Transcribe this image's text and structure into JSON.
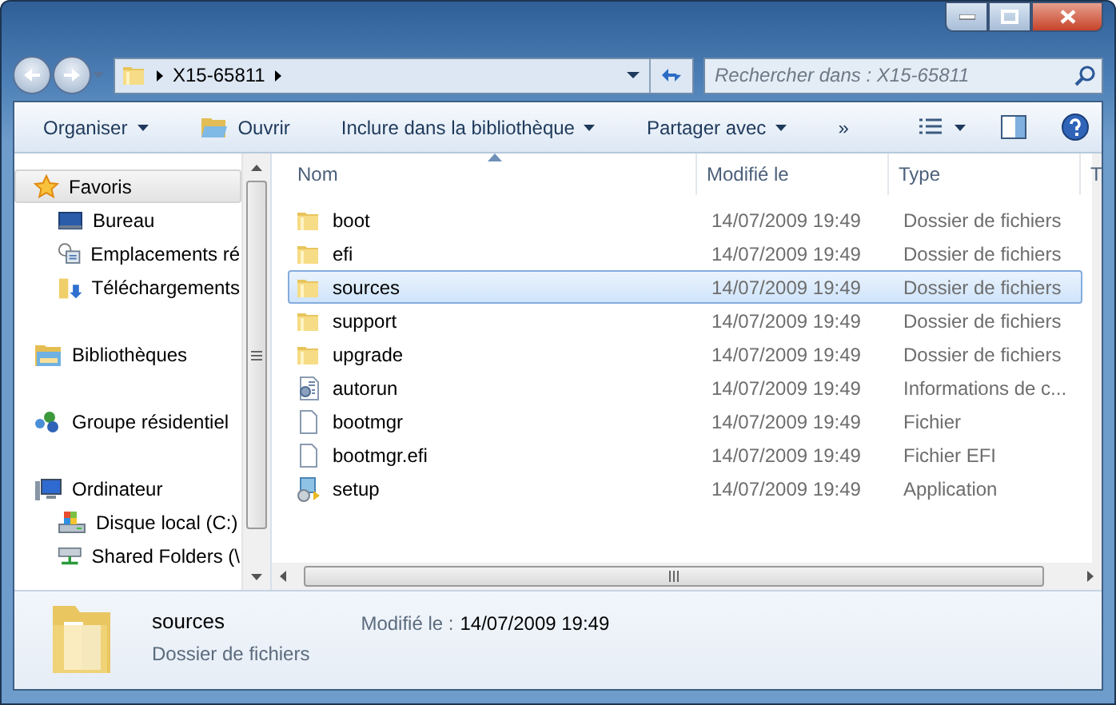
{
  "address_bar": {
    "path": [
      "X15-65811"
    ]
  },
  "search": {
    "placeholder": "Rechercher dans : X15-65811"
  },
  "toolbar": [
    {
      "kind": "menu",
      "label": "Organiser"
    },
    {
      "kind": "open",
      "label": "Ouvrir"
    },
    {
      "kind": "menu",
      "label": "Inclure dans la bibliothèque"
    },
    {
      "kind": "menu",
      "label": "Partager avec"
    },
    {
      "kind": "more",
      "label": "»"
    }
  ],
  "sidebar": {
    "groups": [
      {
        "kind": "star",
        "label": "Favoris",
        "selected": true,
        "children": [
          {
            "kind": "desktop",
            "label": "Bureau",
            "selected": false
          },
          {
            "kind": "places",
            "label": "Emplacements ré",
            "selected": false
          },
          {
            "kind": "downloads",
            "label": "Téléchargements",
            "selected": false
          }
        ]
      },
      {
        "kind": "library",
        "label": "Bibliothèques",
        "selected": false
      },
      {
        "kind": "homegroup",
        "label": "Groupe résidentiel",
        "selected": false
      },
      {
        "kind": "computer",
        "label": "Ordinateur",
        "selected": false,
        "children": [
          {
            "kind": "drive",
            "label": "Disque local (C:)",
            "selected": false
          },
          {
            "kind": "netdrive",
            "label": "Shared Folders (\\",
            "selected": false
          }
        ]
      }
    ]
  },
  "table": {
    "columns": [
      {
        "label": "Nom",
        "sorted": true
      },
      {
        "label": "Modifié le",
        "sorted": false
      },
      {
        "label": "Type",
        "sorted": false
      },
      {
        "label": "T",
        "sorted": false
      }
    ],
    "rows": [
      {
        "kind": "folder",
        "name": "boot",
        "modified": "14/07/2009 19:49",
        "type": "Dossier de fichiers",
        "selected": false
      },
      {
        "kind": "folder",
        "name": "efi",
        "modified": "14/07/2009 19:49",
        "type": "Dossier de fichiers",
        "selected": false
      },
      {
        "kind": "folder",
        "name": "sources",
        "modified": "14/07/2009 19:49",
        "type": "Dossier de fichiers",
        "selected": true
      },
      {
        "kind": "folder",
        "name": "support",
        "modified": "14/07/2009 19:49",
        "type": "Dossier de fichiers",
        "selected": false
      },
      {
        "kind": "folder",
        "name": "upgrade",
        "modified": "14/07/2009 19:49",
        "type": "Dossier de fichiers",
        "selected": false
      },
      {
        "kind": "settings",
        "name": "autorun",
        "modified": "14/07/2009 19:49",
        "type": "Informations de c...",
        "selected": false
      },
      {
        "kind": "file",
        "name": "bootmgr",
        "modified": "14/07/2009 19:49",
        "type": "Fichier",
        "selected": false
      },
      {
        "kind": "file",
        "name": "bootmgr.efi",
        "modified": "14/07/2009 19:49",
        "type": "Fichier EFI",
        "selected": false
      },
      {
        "kind": "setup",
        "name": "setup",
        "modified": "14/07/2009 19:49",
        "type": "Application",
        "selected": false
      }
    ]
  },
  "details": {
    "name": "sources",
    "type": "Dossier de fichiers",
    "modified_label": "Modifié le :",
    "modified_value": "14/07/2009 19:49"
  }
}
